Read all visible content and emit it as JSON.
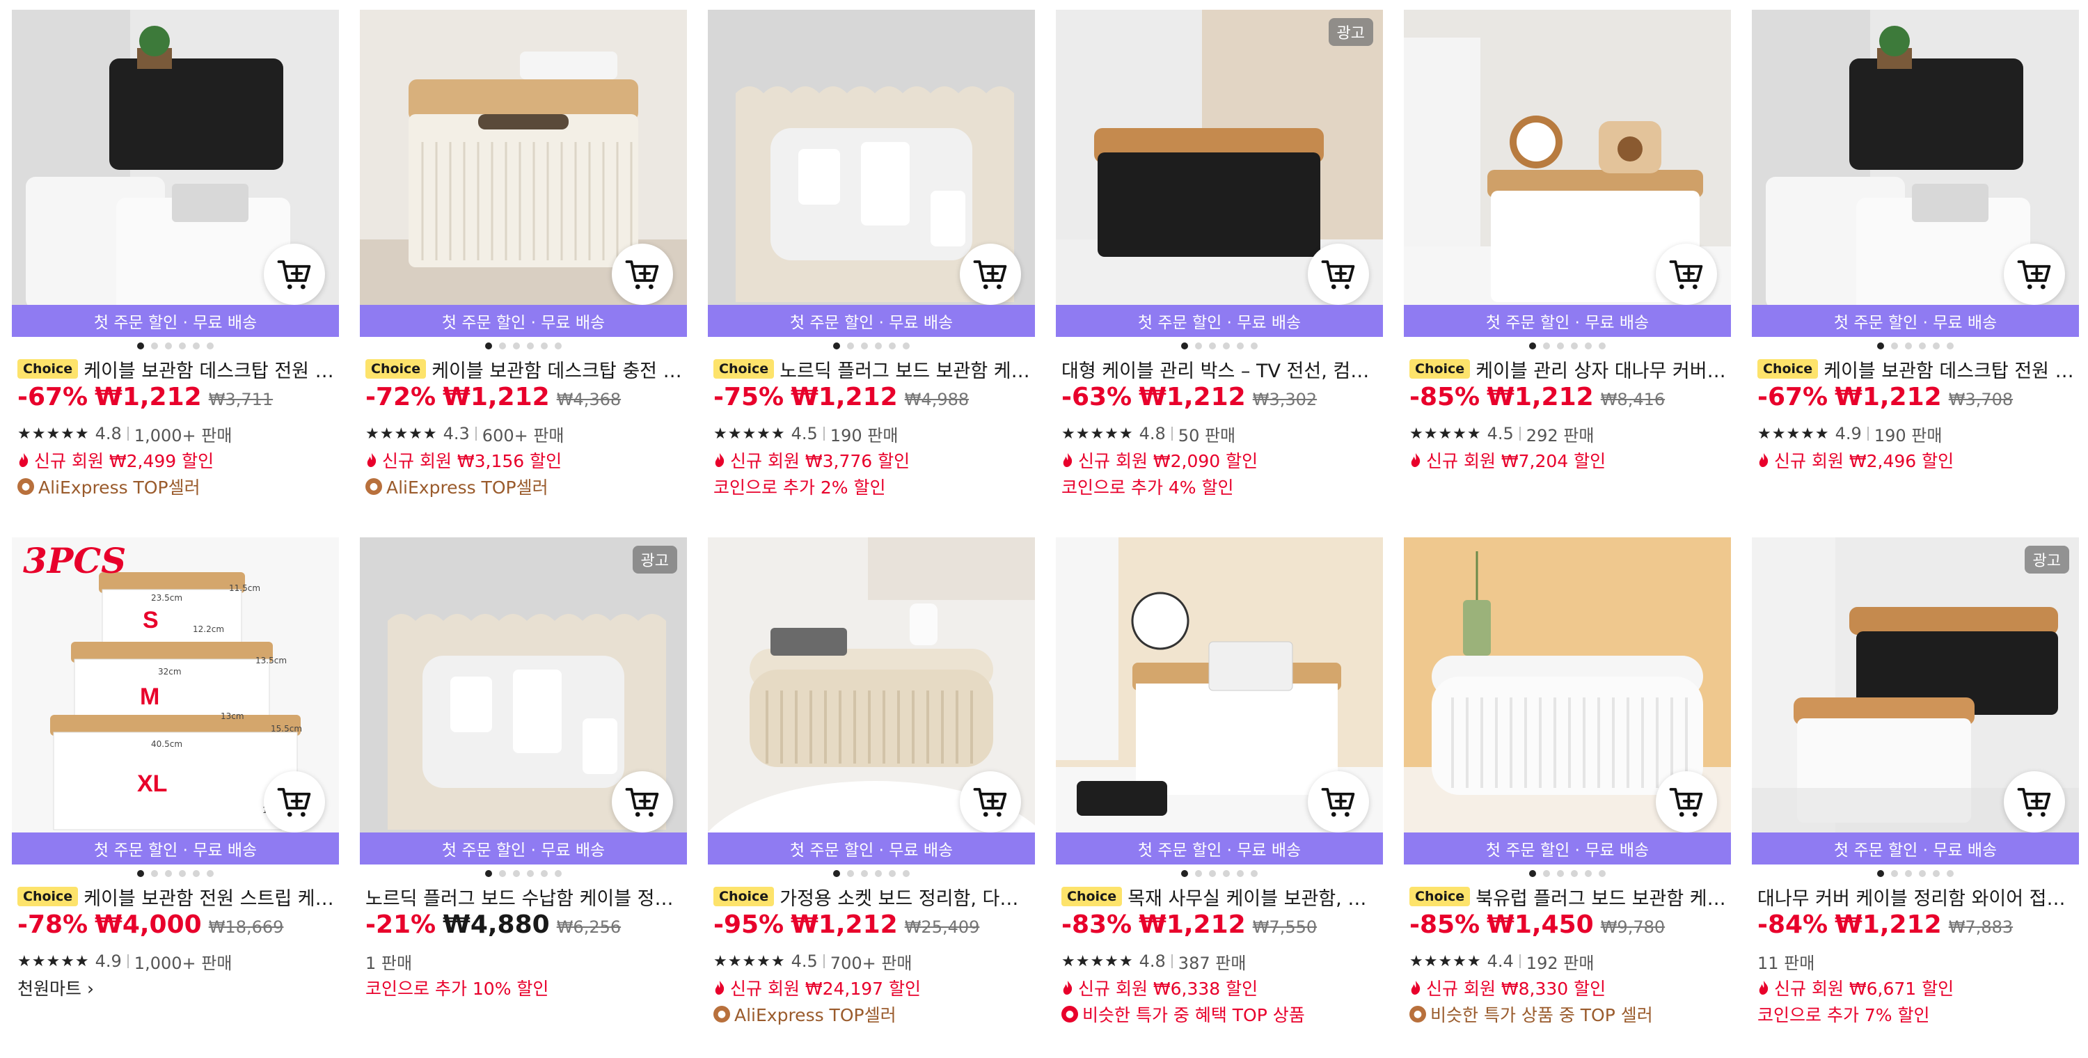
{
  "promo_text": "첫 주문 할인 · 무료 배송",
  "ad_label": "광고",
  "choice_label": "Choice",
  "products": [
    {
      "title": "케이블 보관함 데스크탑 전원 스트...",
      "choice": true,
      "ad": false,
      "discount": "-67%",
      "price": "₩1,212",
      "orig_price": "₩3,711",
      "rating": "4.8",
      "sold": "1,000+ 판매",
      "new_member": "신규 회원 ₩2,499 할인",
      "extra": "AliExpress TOP셀러",
      "extra_type": "top-seller"
    },
    {
      "title": "케이블 보관함 데스크탑 충전 데이...",
      "choice": true,
      "ad": false,
      "discount": "-72%",
      "price": "₩1,212",
      "orig_price": "₩4,368",
      "rating": "4.3",
      "sold": "600+ 판매",
      "new_member": "신규 회원 ₩3,156 할인",
      "extra": "AliExpress TOP셀러",
      "extra_type": "top-seller"
    },
    {
      "title": "노르딕 플러그 보드 보관함 케이블...",
      "choice": true,
      "ad": false,
      "discount": "-75%",
      "price": "₩1,212",
      "orig_price": "₩4,988",
      "rating": "4.5",
      "sold": "190 판매",
      "new_member": "신규 회원 ₩3,776 할인",
      "extra": "코인으로 추가 2% 할인",
      "extra_type": "coin"
    },
    {
      "title": "대형 케이블 관리 박스 – TV 전선, 컴퓨터, ...",
      "choice": false,
      "ad": true,
      "discount": "-63%",
      "price": "₩1,212",
      "orig_price": "₩3,302",
      "rating": "4.8",
      "sold": "50 판매",
      "new_member": "신규 회원 ₩2,090 할인",
      "extra": "코인으로 추가 4% 할인",
      "extra_type": "coin"
    },
    {
      "title": "케이블 관리 상자 대나무 커버 와이...",
      "choice": true,
      "ad": false,
      "discount": "-85%",
      "price": "₩1,212",
      "orig_price": "₩8,416",
      "rating": "4.5",
      "sold": "292 판매",
      "new_member": "신규 회원 ₩7,204 할인",
      "extra": "",
      "extra_type": "none"
    },
    {
      "title": "케이블 보관함 데스크탑 전원 스트...",
      "choice": true,
      "ad": false,
      "discount": "-67%",
      "price": "₩1,212",
      "orig_price": "₩3,708",
      "rating": "4.9",
      "sold": "190 판매",
      "new_member": "신규 회원 ₩2,496 할인",
      "extra": "",
      "extra_type": "none"
    },
    {
      "title": "케이블 보관함 전원 스트립 케이스...",
      "choice": true,
      "ad": false,
      "discount": "-78%",
      "price": "₩4,000",
      "orig_price": "₩18,669",
      "rating": "4.9",
      "sold": "1,000+ 판매",
      "new_member": "",
      "extra": "천원마트 ›",
      "extra_type": "link",
      "overlay": {
        "pcs": "3PCS",
        "s": "S",
        "m": "M",
        "xl": "XL",
        "d1": "23.5cm",
        "d2": "12.2cm",
        "d3": "32cm",
        "d4": "13cm",
        "d5": "40.5cm",
        "d6": "13.6cm",
        "d7": "11.5cm",
        "d8": "13.5cm",
        "d9": "15.5cm"
      }
    },
    {
      "title": "노르딕 플러그 보드 수납함 케이블 정리함...",
      "choice": false,
      "ad": true,
      "discount": "-21%",
      "price": "₩4,880",
      "orig_price": "₩6,256",
      "rating": "",
      "sold": "1 판매",
      "new_member": "",
      "extra": "코인으로 추가 10% 할인",
      "extra_type": "coin"
    },
    {
      "title": "가정용 소켓 보드 정리함, 다기능 ...",
      "choice": true,
      "ad": false,
      "discount": "-95%",
      "price": "₩1,212",
      "orig_price": "₩25,409",
      "rating": "4.5",
      "sold": "700+ 판매",
      "new_member": "신규 회원 ₩24,197 할인",
      "extra": "AliExpress TOP셀러",
      "extra_type": "top-seller"
    },
    {
      "title": "목재 사무실 케이블 보관함, 전력선...",
      "choice": true,
      "ad": false,
      "discount": "-83%",
      "price": "₩1,212",
      "orig_price": "₩7,550",
      "rating": "4.8",
      "sold": "387 판매",
      "new_member": "신규 회원 ₩6,338 할인",
      "extra": "비슷한 특가 중 혜택 TOP 상품",
      "extra_type": "best-deal"
    },
    {
      "title": "북유럽 플러그 보드 보관함 케이블...",
      "choice": true,
      "ad": false,
      "discount": "-85%",
      "price": "₩1,450",
      "orig_price": "₩9,780",
      "rating": "4.4",
      "sold": "192 판매",
      "new_member": "신규 회원 ₩8,330 할인",
      "extra": "비슷한 특가 상품 중 TOP 셀러",
      "extra_type": "top-seller"
    },
    {
      "title": "대나무 커버 케이블 정리함 와이어 접합 보...",
      "choice": false,
      "ad": true,
      "discount": "-84%",
      "price": "₩1,212",
      "orig_price": "₩7,883",
      "rating": "",
      "sold": "11 판매",
      "new_member": "신규 회원 ₩6,671 할인",
      "extra": "코인으로 추가 7% 할인",
      "extra_type": "coin"
    }
  ],
  "colors": {
    "accent_red": "#e8002b",
    "promo_purple": "#8f7bf2",
    "choice_yellow": "#fde36b",
    "top_seller_brown": "#9a5b2c"
  },
  "icons": [
    "cart-add-icon",
    "flame-icon",
    "fire-badge-icon",
    "star-icon",
    "chevron-right-icon"
  ]
}
